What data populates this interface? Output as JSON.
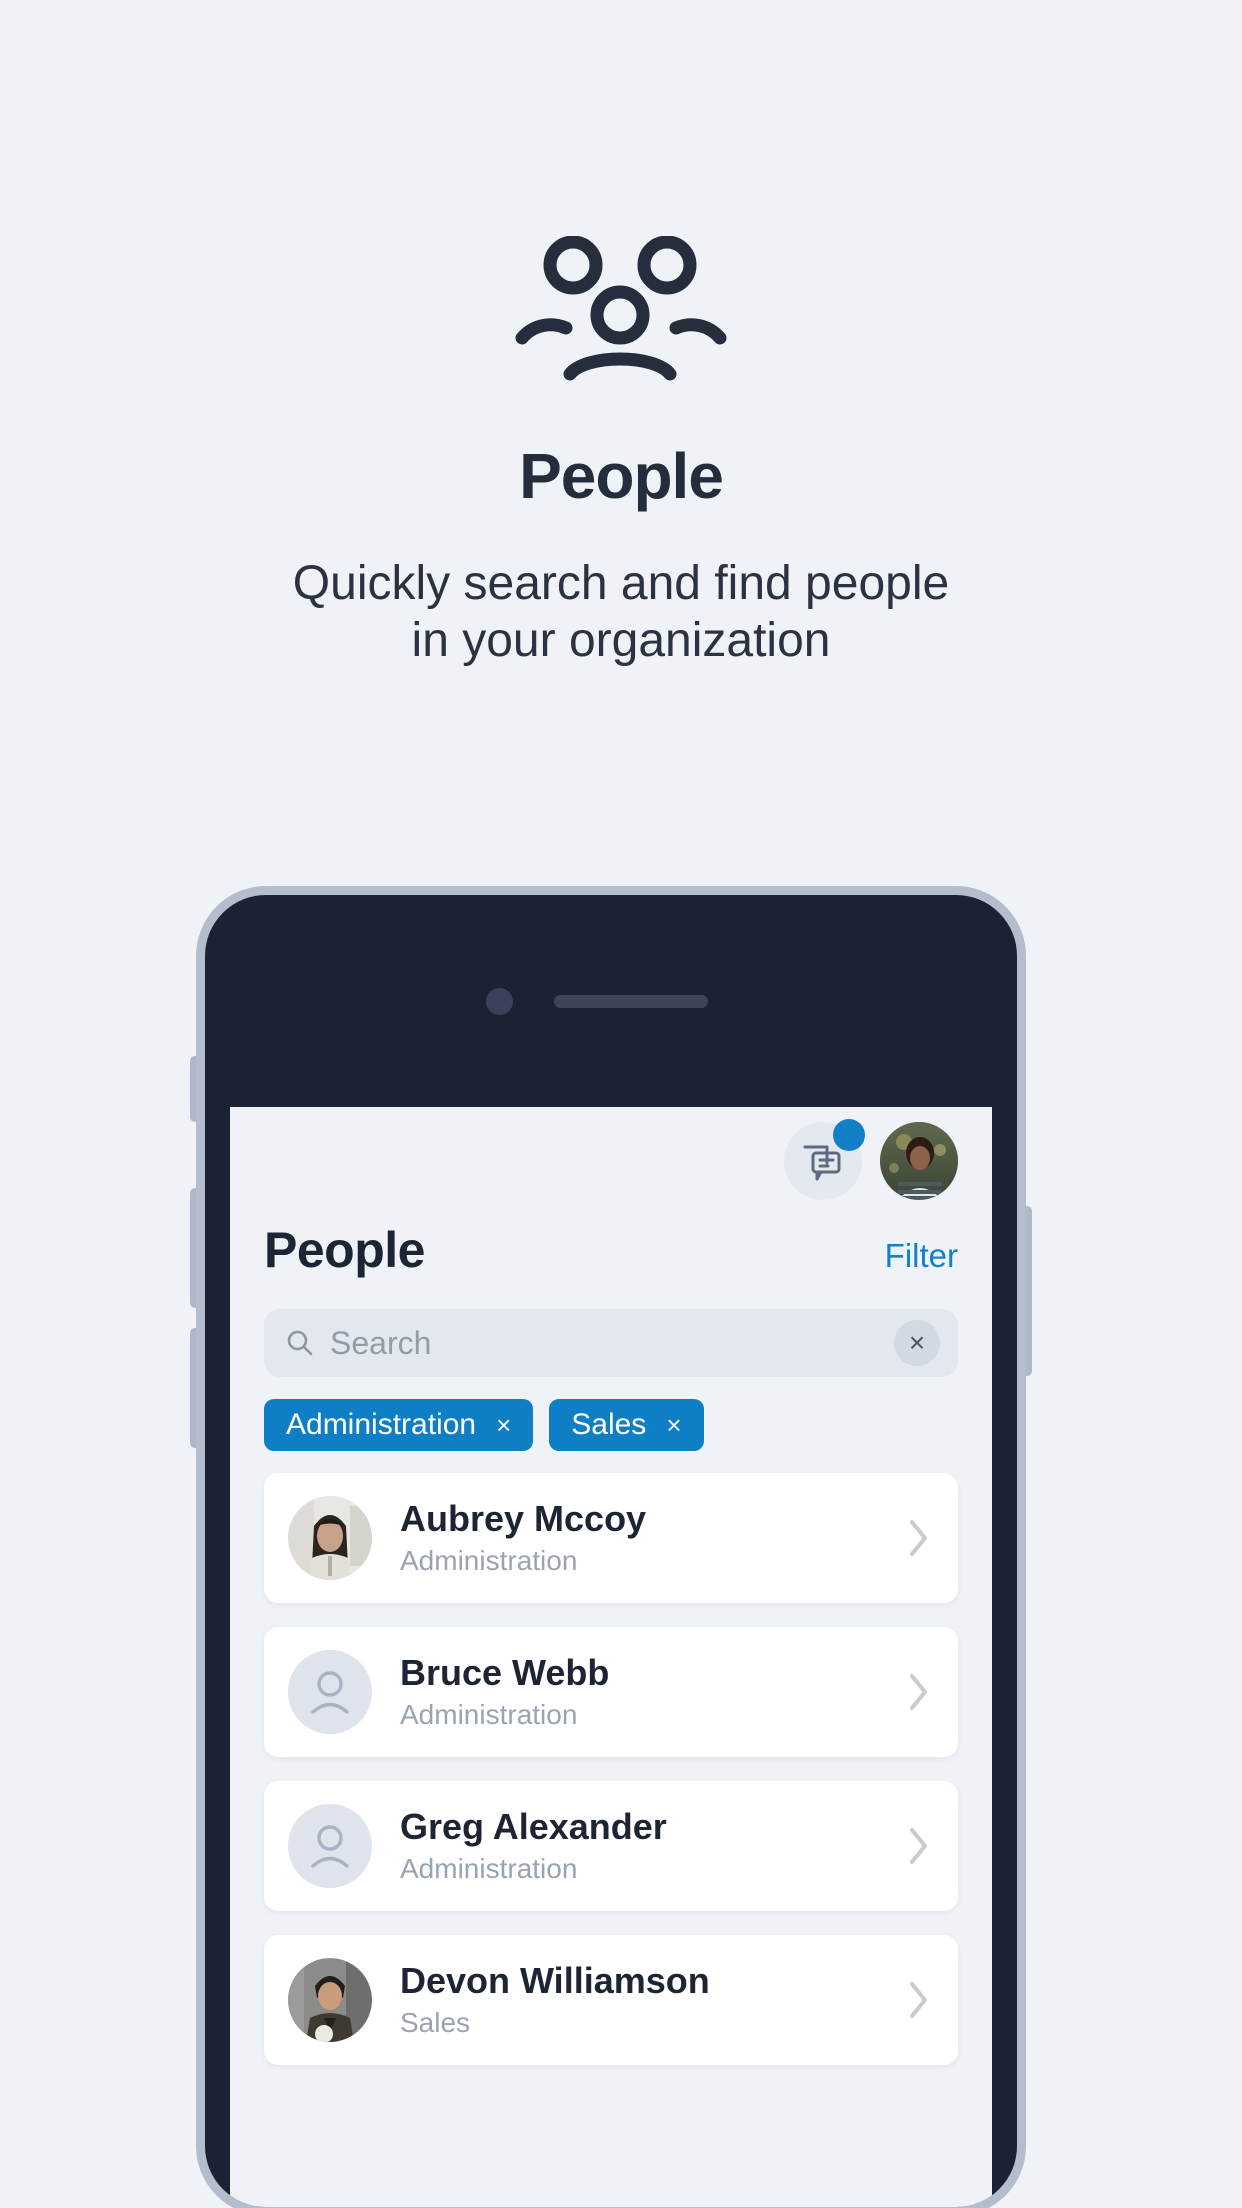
{
  "hero": {
    "icon": "people-group-icon",
    "title": "People",
    "subtitle_line1": "Quickly search and find people",
    "subtitle_line2": "in your organization"
  },
  "colors": {
    "page_background": "#eff2f7",
    "heading_text": "#252d3c",
    "accent_blue": "#0f7fc5",
    "link_blue": "#0f82c8",
    "phone_body": "#1b2233",
    "phone_rim": "#b3bdcb",
    "card_white": "#ffffff",
    "muted_text": "#9aa3b2",
    "chip_blue": "#0f7fc5",
    "badge_blue": "#1180c7"
  },
  "phone": {
    "camera": "camera-dot",
    "speaker": "speaker-grille",
    "buttons": [
      "mute-switch",
      "volume-up-button",
      "volume-down-button",
      "power-button"
    ]
  },
  "app": {
    "topbar": {
      "chat_icon": "chat-bubbles-icon",
      "chat_badge": "unread-dot",
      "avatar": "user-avatar"
    },
    "header": {
      "title": "People",
      "filter_label": "Filter"
    },
    "search": {
      "icon": "search-icon",
      "placeholder": "Search",
      "value": "",
      "clear_label": "×"
    },
    "chips": [
      {
        "label": "Administration",
        "remove": "×"
      },
      {
        "label": "Sales",
        "remove": "×"
      }
    ],
    "people": [
      {
        "name": "Aubrey Mccoy",
        "role": "Administration",
        "avatar": "photo",
        "chevron": "chevron-right-icon"
      },
      {
        "name": "Bruce Webb",
        "role": "Administration",
        "avatar": "placeholder",
        "chevron": "chevron-right-icon"
      },
      {
        "name": "Greg Alexander",
        "role": "Administration",
        "avatar": "placeholder",
        "chevron": "chevron-right-icon"
      },
      {
        "name": "Devon Williamson",
        "role": "Sales",
        "avatar": "photo",
        "chevron": "chevron-right-icon"
      }
    ]
  }
}
